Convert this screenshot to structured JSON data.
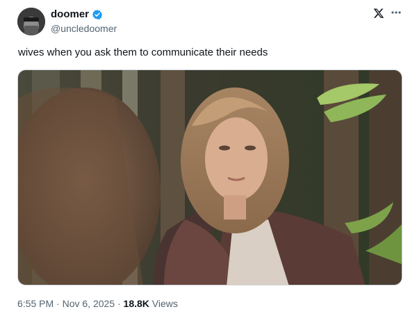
{
  "author": {
    "display_name": "doomer",
    "handle": "@uncledoomer",
    "verified": true
  },
  "post": {
    "text": "wives when you ask them to communicate their needs",
    "time": "6:55 PM",
    "separator": "·",
    "date": "Nov 6, 2025",
    "views_count": "18.8K",
    "views_label": "Views"
  },
  "icons": {
    "verified": "verified-badge-icon",
    "brand": "x-logo-icon",
    "more": "more-options-icon"
  },
  "colors": {
    "verified_blue": "#1d9bf0",
    "secondary_text": "#536471",
    "primary_text": "#0f1419"
  }
}
